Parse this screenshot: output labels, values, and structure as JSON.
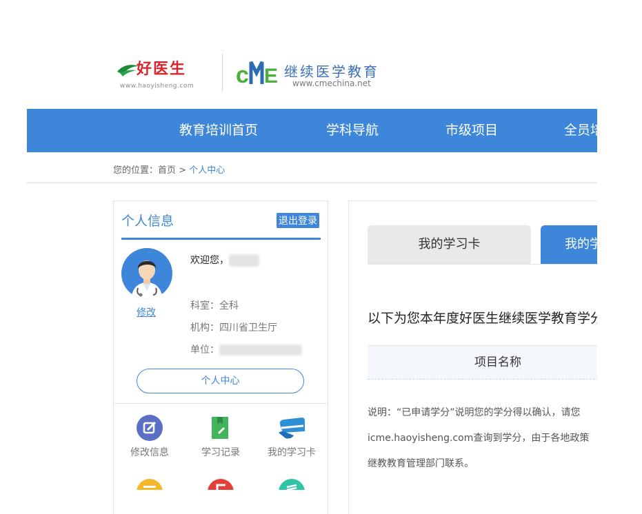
{
  "logos": {
    "haoyisheng": {
      "name": "好医生",
      "url": "www.haoyisheng.com"
    },
    "cme": {
      "mark": "CME",
      "title": "继续医学教育",
      "url": "www.cmechina.net"
    }
  },
  "nav": [
    "教育培训首页",
    "学科导航",
    "市级项目",
    "全员培训"
  ],
  "breadcrumb": {
    "prefix": "您的位置：",
    "home": "首页",
    "sep": " > ",
    "current": "个人中心"
  },
  "profile": {
    "title": "个人信息",
    "logout": "退出登录",
    "welcome": "欢迎您，",
    "edit": "修改",
    "department": "科室：全科",
    "institution": "机构：四川省卫生厅",
    "unit": "单位：",
    "center_button": "个人中心"
  },
  "quick_links": [
    {
      "label": "修改信息",
      "icon": "edit-icon",
      "color": "#5b6fc5"
    },
    {
      "label": "学习记录",
      "icon": "notebook-icon",
      "color": "#3fb65a"
    },
    {
      "label": "我的学习卡",
      "icon": "card-icon",
      "color": "#2f8fd6"
    }
  ],
  "quick_links_row2": [
    {
      "icon": "message-icon",
      "color": "#f4b82a"
    },
    {
      "icon": "certificate-icon",
      "color": "#e4403b"
    },
    {
      "icon": "list-icon",
      "color": "#2ec4a5"
    }
  ],
  "tabs": [
    "我的学习卡",
    "我的学分"
  ],
  "intro": "以下为您本年度好医生继续医学教育学分",
  "table": {
    "header": "项目名称"
  },
  "notes": [
    "说明：“已申请学分”说明您的学分得以确认，请您",
    "icme.haoyisheng.com查询到学分，由于各地政策",
    "继教教育管理部门联系。"
  ]
}
